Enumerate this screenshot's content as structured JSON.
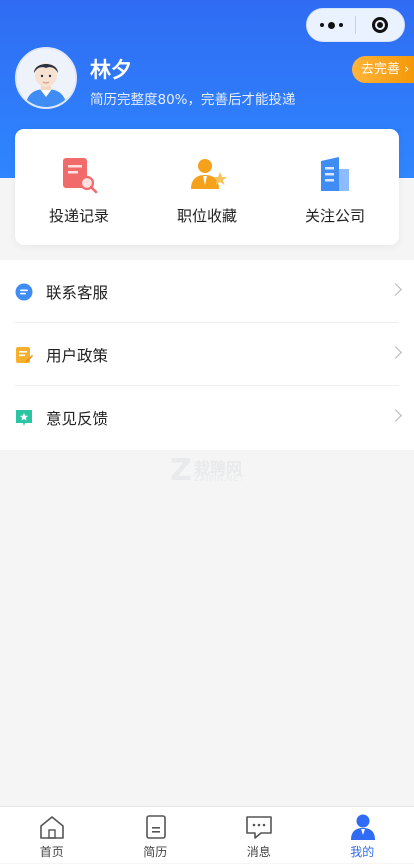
{
  "profile": {
    "name": "林夕",
    "subtitle": "简历完整度80%，完善后才能投递",
    "complete_label": "去完善"
  },
  "quick_actions": [
    {
      "label": "投递记录",
      "icon": "resume-search-icon"
    },
    {
      "label": "职位收藏",
      "icon": "person-star-icon"
    },
    {
      "label": "关注公司",
      "icon": "building-icon"
    }
  ],
  "menu": [
    {
      "label": "联系客服",
      "icon": "chat-bubble-icon"
    },
    {
      "label": "用户政策",
      "icon": "document-edit-icon"
    },
    {
      "label": "意见反馈",
      "icon": "feedback-star-icon"
    }
  ],
  "watermark": {
    "cn": "栽聘网",
    "en": "ZAIPIN.NET"
  },
  "tabbar": [
    {
      "label": "首页",
      "icon": "home-icon",
      "active": false
    },
    {
      "label": "简历",
      "icon": "resume-icon",
      "active": false
    },
    {
      "label": "消息",
      "icon": "message-icon",
      "active": false
    },
    {
      "label": "我的",
      "icon": "user-icon",
      "active": true
    }
  ],
  "colors": {
    "brand_blue": "#2f6cf3",
    "orange": "#f5a11c",
    "background": "#f5f5f5"
  }
}
